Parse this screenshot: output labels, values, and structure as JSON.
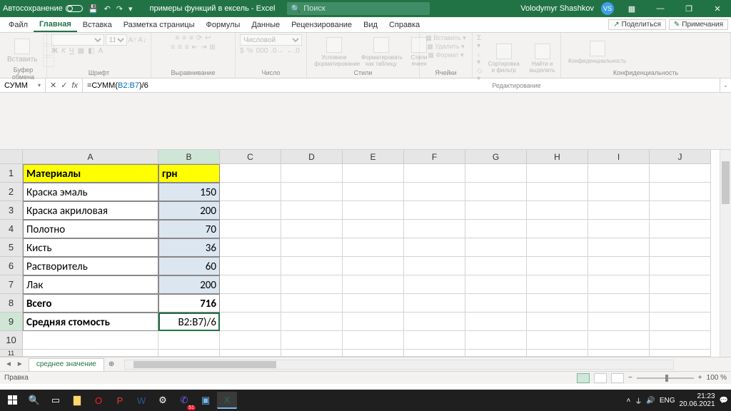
{
  "title_bar": {
    "autosave_label": "Автосохранение",
    "doc_title": "примеры функций в ексель - Excel",
    "search_placeholder": "Поиск",
    "user_name": "Volodymyr Shashkov",
    "user_initials": "VS"
  },
  "ribbon_tabs": [
    "Файл",
    "Главная",
    "Вставка",
    "Разметка страницы",
    "Формулы",
    "Данные",
    "Рецензирование",
    "Вид",
    "Справка"
  ],
  "ribbon_active_tab": "Главная",
  "ribbon_right": {
    "share": "Поделиться",
    "notes": "Примечания"
  },
  "ribbon_groups": {
    "clipboard": {
      "label": "Буфер обмена",
      "paste": "Вставить"
    },
    "font": {
      "label": "Шрифт",
      "size": "11"
    },
    "alignment": {
      "label": "Выравнивание"
    },
    "number": {
      "label": "Число",
      "format": "Числовой"
    },
    "styles": {
      "label": "Стили",
      "cond": "Условное форматирование",
      "table": "Форматировать как таблицу",
      "cell": "Стили ячеек"
    },
    "cells": {
      "label": "Ячейки",
      "insert": "Вставить",
      "delete": "Удалить",
      "format": "Формат"
    },
    "editing": {
      "label": "Редактирование",
      "sort": "Сортировка и фильтр",
      "find": "Найти и выделить"
    },
    "confidential": {
      "label": "Конфиденциальность",
      "btn": "Конфиденциальность"
    }
  },
  "formula_bar": {
    "name_box": "СУММ",
    "formula_prefix": "=СУММ(",
    "formula_ref": "B2:B7",
    "formula_suffix": ")/6"
  },
  "columns": [
    "A",
    "B",
    "C",
    "D",
    "E",
    "F",
    "G",
    "H",
    "I",
    "J"
  ],
  "active_col": "B",
  "active_row": 9,
  "rows": [
    {
      "n": 1,
      "A": "Материалы",
      "B": "грн",
      "a_class": "header-yellow bordered",
      "b_class": "header-yellow bordered"
    },
    {
      "n": 2,
      "A": "Краска эмаль",
      "B": "150",
      "a_class": "bordered",
      "b_class": "b-fill bordered"
    },
    {
      "n": 3,
      "A": "Краска акриловая",
      "B": "200",
      "a_class": "bordered",
      "b_class": "b-fill bordered"
    },
    {
      "n": 4,
      "A": "Полотно",
      "B": "70",
      "a_class": "bordered",
      "b_class": "b-fill bordered"
    },
    {
      "n": 5,
      "A": "Кисть",
      "B": "36",
      "a_class": "bordered",
      "b_class": "b-fill bordered"
    },
    {
      "n": 6,
      "A": "Растворитель",
      "B": "60",
      "a_class": "bordered",
      "b_class": "b-fill bordered"
    },
    {
      "n": 7,
      "A": "Лак",
      "B": "200",
      "a_class": "bordered",
      "b_class": "b-fill bordered"
    },
    {
      "n": 8,
      "A": "Всего",
      "B": "716",
      "a_class": "bold bordered",
      "b_class": "bold right bordered"
    },
    {
      "n": 9,
      "A": "Средняя стомость",
      "B": "B2:B7)/6",
      "a_class": "bold bordered",
      "b_class": "right editing"
    },
    {
      "n": 10,
      "A": "",
      "B": ""
    },
    {
      "n": 11,
      "A": "",
      "B": ""
    }
  ],
  "sheet_tabs": {
    "active": "среднее значение"
  },
  "status_bar": {
    "mode": "Правка",
    "zoom": "100 %"
  },
  "taskbar": {
    "lang": "ENG",
    "time": "21:23",
    "date": "20.06.2021",
    "notif_count": "51"
  },
  "colors": {
    "accent": "#217346",
    "highlight": "#ffff00",
    "fill": "#dce6f1"
  }
}
